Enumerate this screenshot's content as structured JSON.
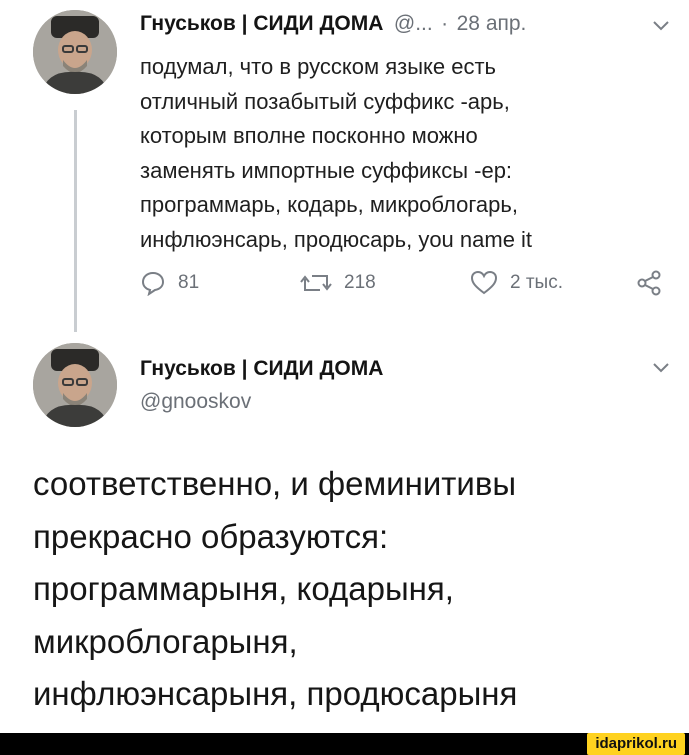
{
  "tweet1": {
    "author_name": "Гнуськов | СИДИ ДОМА",
    "handle_truncated": "@...",
    "separator": "·",
    "date": "28 апр.",
    "text": "подумал, что в русском языке есть\nотличный позабытый суффикс -арь,\nкоторым вполне посконно можно\nзаменять импортные суффиксы -ер:\nпрограммарь, кодарь, микроблогарь,\nинфлюэнсарь, продюсарь, you name it",
    "actions": {
      "reply_count": "81",
      "retweet_count": "218",
      "like_count": "2 тыс."
    }
  },
  "tweet2": {
    "author_name": "Гнуськов | СИДИ ДОМА",
    "handle": "@gnooskov",
    "text": "соответственно, и феминитивы\nпрекрасно образуются:\nпрограммарыня, кодарыня,\nмикроблогарыня,\nинфлюэнсарыня, продюсарыня"
  },
  "icons": {
    "reply": "comment-icon",
    "retweet": "retweet-icon",
    "like": "heart-icon",
    "share": "share-icon",
    "menu": "chevron-down-icon"
  },
  "colors": {
    "text": "#1f1f1f",
    "muted": "#6b7077",
    "thread_line": "#c9cdd1",
    "watermark_bg": "#ffd21f"
  },
  "watermark": "idaprikol.ru"
}
